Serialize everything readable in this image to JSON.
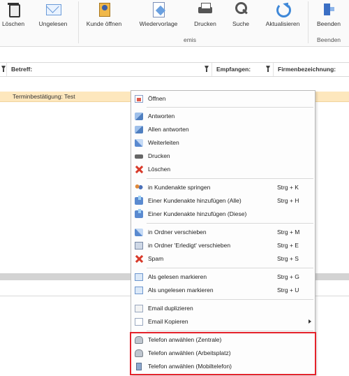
{
  "ribbon": {
    "buttons": [
      {
        "label": "Löschen",
        "icon": "trash-icon"
      },
      {
        "label": "Ungelesen",
        "icon": "envelope-icon"
      },
      {
        "label": "Kunde öffnen",
        "icon": "customer-file-icon"
      },
      {
        "label": "Wiedervorlage",
        "icon": "resubmission-icon"
      },
      {
        "label": "Drucken",
        "icon": "printer-icon"
      },
      {
        "label": "Suche",
        "icon": "magnifier-icon"
      },
      {
        "label": "Aktualisieren",
        "icon": "refresh-icon"
      },
      {
        "label": "Beenden",
        "icon": "exit-icon"
      }
    ],
    "groups": {
      "emis": "emis",
      "beenden": "Beenden"
    }
  },
  "columns": {
    "betreff": "Betreff:",
    "empfangen": "Empfangen:",
    "firma": "Firmenbezeichnung:"
  },
  "selected_row": {
    "subject": "Terminbestätigung: Test"
  },
  "context_menu": {
    "items": [
      {
        "label": "Öffnen",
        "shortcut": "",
        "icon": "open-icon"
      },
      {
        "label": "Antworten",
        "shortcut": "",
        "icon": "reply-icon"
      },
      {
        "label": "Allen antworten",
        "shortcut": "",
        "icon": "reply-all-icon"
      },
      {
        "label": "Weiterleiten",
        "shortcut": "",
        "icon": "forward-icon"
      },
      {
        "label": "Drucken",
        "shortcut": "",
        "icon": "printer-icon"
      },
      {
        "label": "Löschen",
        "shortcut": "",
        "icon": "delete-icon"
      },
      {
        "label": "in Kundenakte springen",
        "shortcut": "Strg + K",
        "icon": "customers-icon"
      },
      {
        "label": "Einer Kundenakte hinzufügen (Alle)",
        "shortcut": "Strg + H",
        "icon": "add-to-file-icon"
      },
      {
        "label": "Einer Kundenakte hinzufügen (Diese)",
        "shortcut": "",
        "icon": "add-to-file-icon"
      },
      {
        "label": "in Ordner verschieben",
        "shortcut": "Strg + M",
        "icon": "move-folder-icon"
      },
      {
        "label": "in Ordner 'Erledigt' verschieben",
        "shortcut": "Strg + E",
        "icon": "done-folder-icon"
      },
      {
        "label": "Spam",
        "shortcut": "Strg + S",
        "icon": "spam-icon"
      },
      {
        "label": "Als gelesen markieren",
        "shortcut": "Strg + G",
        "icon": "mark-read-icon"
      },
      {
        "label": "Als ungelesen markieren",
        "shortcut": "Strg + U",
        "icon": "mark-unread-icon"
      },
      {
        "label": "Email duplizieren",
        "shortcut": "",
        "icon": "duplicate-icon"
      },
      {
        "label": "Email Kopieren",
        "shortcut": "",
        "icon": "copy-icon"
      },
      {
        "label": "Telefon anwählen (Zentrale)",
        "shortcut": "",
        "icon": "phone-icon"
      },
      {
        "label": "Telefon anwählen (Arbeitsplatz)",
        "shortcut": "",
        "icon": "phone-icon"
      },
      {
        "label": "Telefon anwählen (Mobiltelefon)",
        "shortcut": "",
        "icon": "mobile-phone-icon"
      }
    ]
  },
  "colors": {
    "selection": "#fde7bd",
    "highlight_border": "#e4222b"
  }
}
